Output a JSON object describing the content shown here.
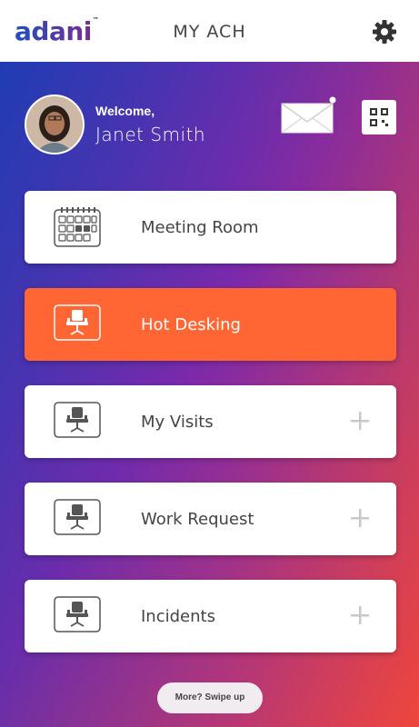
{
  "header": {
    "logo_text": "adani",
    "logo_tm": "™",
    "title": "MY ACH",
    "settings_icon": "gear-icon"
  },
  "profile": {
    "greeting": "Welcome,",
    "name": "Janet Smith",
    "mail_icon": "envelope-icon",
    "mail_has_notification": true,
    "qr_icon": "qr-code-icon"
  },
  "menu": [
    {
      "label": "Meeting Room",
      "icon": "calendar-icon",
      "active": false,
      "has_add": false
    },
    {
      "label": "Hot Desking",
      "icon": "chair-icon",
      "active": true,
      "has_add": false
    },
    {
      "label": "My Visits",
      "icon": "chair-icon",
      "active": false,
      "has_add": true
    },
    {
      "label": "Work Request",
      "icon": "chair-icon",
      "active": false,
      "has_add": true
    },
    {
      "label": "Incidents",
      "icon": "chair-icon",
      "active": false,
      "has_add": true
    }
  ],
  "footer": {
    "swipe_label": "More? Swipe up"
  },
  "colors": {
    "accent_orange": "#ff6633",
    "logo_blue": "#1f4fbf",
    "logo_purple": "#7a2c8f"
  }
}
